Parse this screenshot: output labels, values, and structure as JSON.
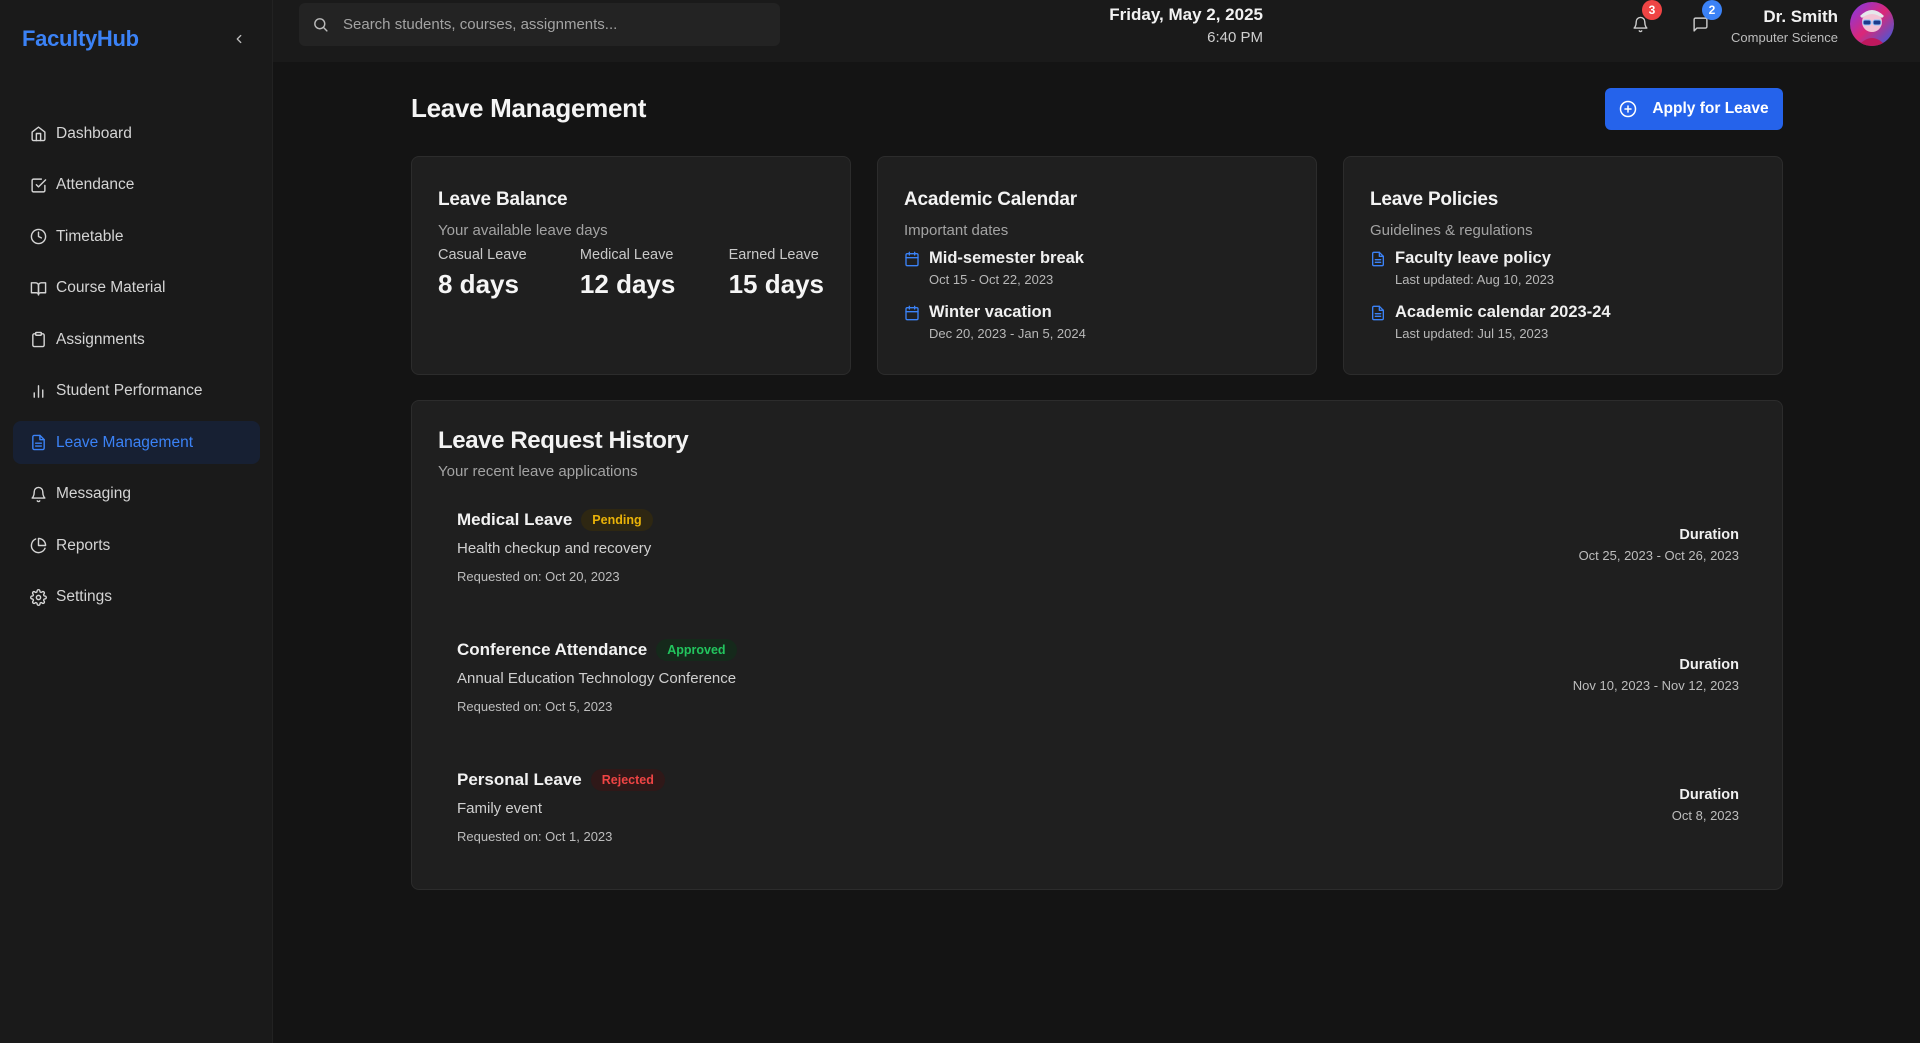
{
  "brand": "FacultyHub",
  "sidebar": {
    "items": [
      {
        "label": "Dashboard"
      },
      {
        "label": "Attendance"
      },
      {
        "label": "Timetable"
      },
      {
        "label": "Course Material"
      },
      {
        "label": "Assignments"
      },
      {
        "label": "Student Performance"
      },
      {
        "label": "Leave Management"
      },
      {
        "label": "Messaging"
      },
      {
        "label": "Reports"
      },
      {
        "label": "Settings"
      }
    ],
    "active": "Leave Management"
  },
  "topbar": {
    "search_placeholder": "Search students, courses, assignments...",
    "date": "Friday, May 2, 2025",
    "time": "6:40 PM",
    "notifications_count": "3",
    "messages_count": "2",
    "user_name": "Dr. Smith",
    "user_dept": "Computer Science"
  },
  "page": {
    "title": "Leave Management",
    "apply_label": "Apply for Leave"
  },
  "leave_balance": {
    "title": "Leave Balance",
    "subtitle": "Your available leave days",
    "items": [
      {
        "label": "Casual Leave",
        "value": "8 days"
      },
      {
        "label": "Medical Leave",
        "value": "12 days"
      },
      {
        "label": "Earned Leave",
        "value": "15 days"
      }
    ]
  },
  "calendar": {
    "title": "Academic Calendar",
    "subtitle": "Important dates",
    "events": [
      {
        "title": "Mid-semester break",
        "dates": "Oct 15 - Oct 22, 2023"
      },
      {
        "title": "Winter vacation",
        "dates": "Dec 20, 2023 - Jan 5, 2024"
      }
    ]
  },
  "policies": {
    "title": "Leave Policies",
    "subtitle": "Guidelines & regulations",
    "docs": [
      {
        "title": "Faculty leave policy",
        "updated": "Last updated: Aug 10, 2023"
      },
      {
        "title": "Academic calendar 2023-24",
        "updated": "Last updated: Jul 15, 2023"
      }
    ]
  },
  "history": {
    "title": "Leave Request History",
    "subtitle": "Your recent leave applications",
    "duration_label": "Duration",
    "requests": [
      {
        "type": "Medical Leave",
        "status": "Pending",
        "reason": "Health checkup and recovery",
        "requested": "Requested on: Oct 20, 2023",
        "duration": "Oct 25, 2023 - Oct 26, 2023"
      },
      {
        "type": "Conference Attendance",
        "status": "Approved",
        "reason": "Annual Education Technology Conference",
        "requested": "Requested on: Oct 5, 2023",
        "duration": "Nov 10, 2023 - Nov 12, 2023"
      },
      {
        "type": "Personal Leave",
        "status": "Rejected",
        "reason": "Family event",
        "requested": "Requested on: Oct 1, 2023",
        "duration": "Oct 8, 2023"
      }
    ]
  },
  "colors": {
    "accent": "#3b82f6",
    "primary_button": "#2563eb",
    "notif_badge": "#ef4444",
    "msg_badge": "#3b82f6",
    "pending": "#eab308",
    "approved": "#22c55e",
    "rejected": "#ef4444"
  }
}
